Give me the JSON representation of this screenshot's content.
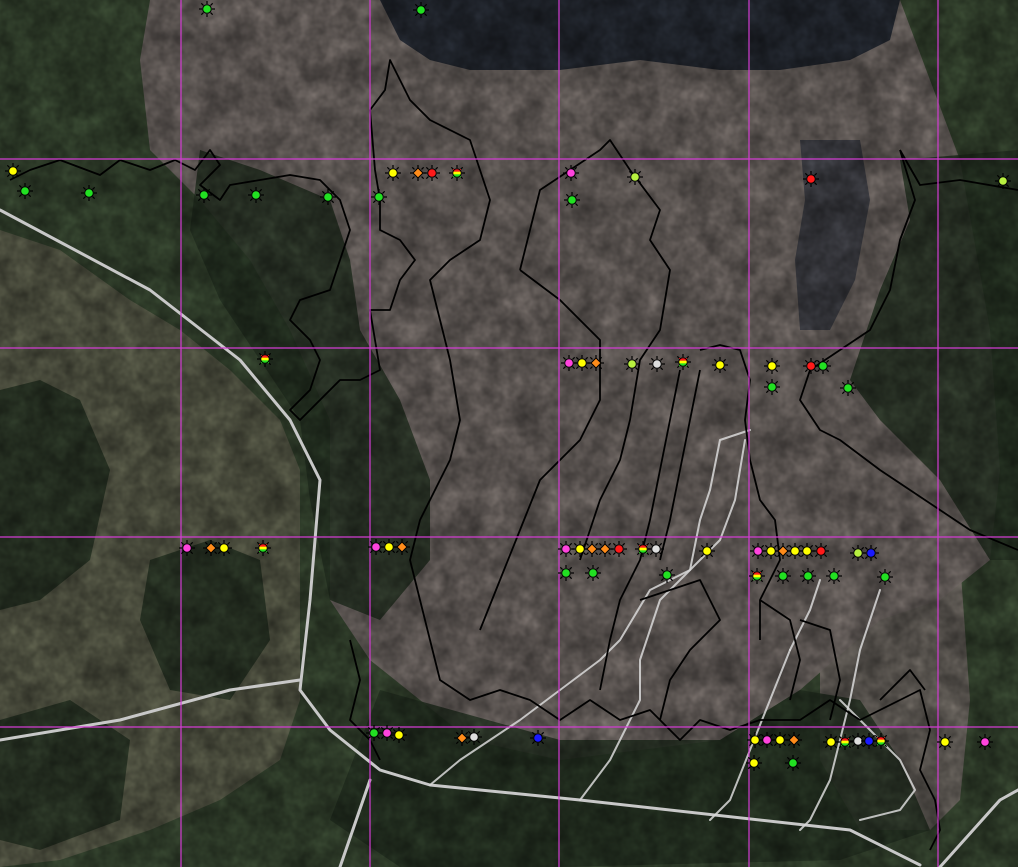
{
  "map": {
    "title": "",
    "imagery": "aerial-satellite",
    "colors": {
      "grid": "#d23cd2",
      "boundary": "#000000",
      "trail": "#d9d9d9",
      "road": "#c8c8c8",
      "forest_dark": "#2f3f2c",
      "forest_mid": "#465a3e",
      "bog": "#8f8580",
      "lake": "#2f3540",
      "clearing": "#9a8f7a"
    },
    "grid_lines": {
      "count_vertical": 5,
      "count_horizontal": 4
    },
    "marker_types": [
      {
        "name": "green",
        "fill": "#22e022"
      },
      {
        "name": "yellow",
        "fill": "#ffff00"
      },
      {
        "name": "magenta",
        "fill": "#ff44dd"
      },
      {
        "name": "orange",
        "fill": "#ff8c1a"
      },
      {
        "name": "red",
        "fill": "#ff1a1a"
      },
      {
        "name": "blue",
        "fill": "#1a1aff"
      },
      {
        "name": "white",
        "fill": "#dddddd"
      },
      {
        "name": "yellow-green",
        "fill": "#b8f040"
      },
      {
        "name": "multi-color",
        "fill": "#ff8c1a"
      }
    ],
    "markers": [
      {
        "type": "green"
      },
      {
        "type": "green"
      },
      {
        "type": "yellow"
      },
      {
        "type": "green"
      },
      {
        "type": "green"
      },
      {
        "type": "green"
      },
      {
        "type": "green"
      },
      {
        "type": "green"
      },
      {
        "type": "green"
      },
      {
        "type": "yellow"
      },
      {
        "type": "orange"
      },
      {
        "type": "red"
      },
      {
        "type": "multi-color"
      },
      {
        "type": "magenta"
      },
      {
        "type": "green"
      },
      {
        "type": "yellow-green"
      },
      {
        "type": "red"
      },
      {
        "type": "yellow-green"
      },
      {
        "type": "multi-color"
      },
      {
        "type": "magenta"
      },
      {
        "type": "yellow"
      },
      {
        "type": "orange"
      },
      {
        "type": "yellow-green"
      },
      {
        "type": "white"
      },
      {
        "type": "multi-color"
      },
      {
        "type": "yellow"
      },
      {
        "type": "yellow"
      },
      {
        "type": "green"
      },
      {
        "type": "red"
      },
      {
        "type": "green"
      },
      {
        "type": "green"
      },
      {
        "type": "magenta"
      },
      {
        "type": "orange"
      },
      {
        "type": "yellow"
      },
      {
        "type": "multi-color"
      },
      {
        "type": "magenta"
      },
      {
        "type": "yellow"
      },
      {
        "type": "orange"
      },
      {
        "type": "magenta"
      },
      {
        "type": "yellow"
      },
      {
        "type": "orange"
      },
      {
        "type": "orange"
      },
      {
        "type": "red"
      },
      {
        "type": "multi-color"
      },
      {
        "type": "white"
      },
      {
        "type": "yellow"
      },
      {
        "type": "green"
      },
      {
        "type": "green"
      },
      {
        "type": "green"
      },
      {
        "type": "magenta"
      },
      {
        "type": "yellow"
      },
      {
        "type": "orange"
      },
      {
        "type": "yellow"
      },
      {
        "type": "yellow"
      },
      {
        "type": "red"
      },
      {
        "type": "yellow-green"
      },
      {
        "type": "blue"
      },
      {
        "type": "multi-color"
      },
      {
        "type": "green"
      },
      {
        "type": "green"
      },
      {
        "type": "green"
      },
      {
        "type": "green"
      },
      {
        "type": "green"
      },
      {
        "type": "magenta"
      },
      {
        "type": "yellow"
      },
      {
        "type": "orange"
      },
      {
        "type": "white"
      },
      {
        "type": "blue"
      },
      {
        "type": "yellow"
      },
      {
        "type": "magenta"
      },
      {
        "type": "yellow"
      },
      {
        "type": "orange"
      },
      {
        "type": "yellow"
      },
      {
        "type": "multi-color"
      },
      {
        "type": "white"
      },
      {
        "type": "blue"
      },
      {
        "type": "multi-color"
      },
      {
        "type": "yellow"
      },
      {
        "type": "magenta"
      },
      {
        "type": "yellow"
      },
      {
        "type": "green"
      },
      {
        "type": "green"
      }
    ]
  }
}
